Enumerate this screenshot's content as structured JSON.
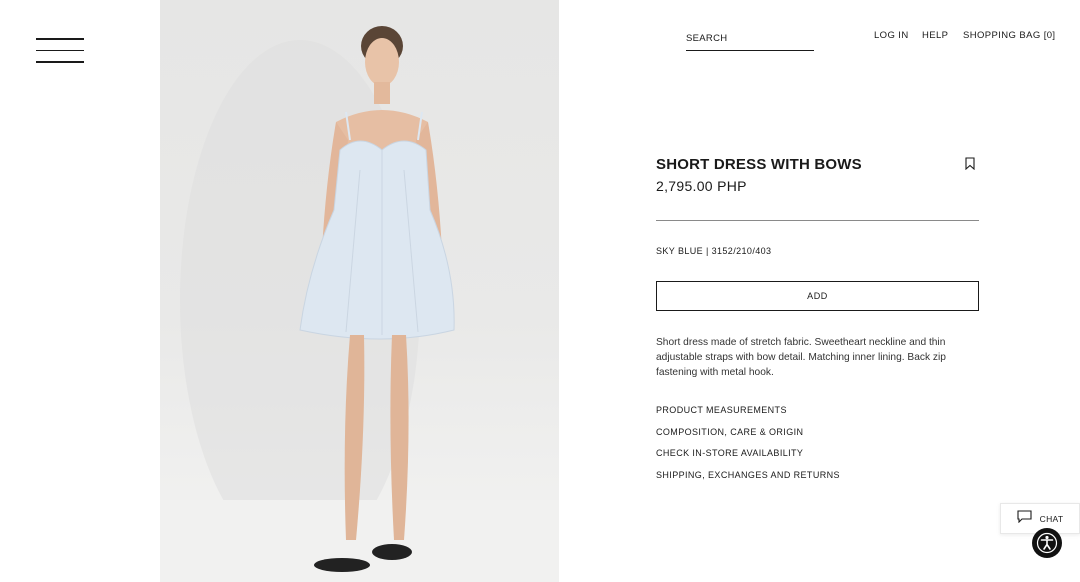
{
  "header": {
    "search_placeholder": "SEARCH",
    "login": "LOG IN",
    "help": "HELP",
    "shopping_bag": "SHOPPING BAG [0]"
  },
  "product": {
    "title": "SHORT DRESS WITH BOWS",
    "price": "2,795.00 PHP",
    "color_ref": "SKY BLUE | 3152/210/403",
    "add_label": "ADD",
    "description": "Short dress made of stretch fabric. Sweetheart neckline and thin adjustable straps with bow detail. Matching inner lining. Back zip fastening with metal hook.",
    "links": [
      "PRODUCT MEASUREMENTS",
      "COMPOSITION, CARE & ORIGIN",
      "CHECK IN-STORE AVAILABILITY",
      "SHIPPING, EXCHANGES AND RETURNS"
    ]
  },
  "chat": {
    "label": "CHAT"
  },
  "icons": {
    "menu": "hamburger-menu-icon",
    "bookmark": "bookmark-icon",
    "chat": "chat-bubble-icon",
    "accessibility": "accessibility-icon"
  },
  "colors": {
    "text": "#1a1a1a",
    "dress": "#dde7f1",
    "accessibility_bg": "#111111"
  }
}
